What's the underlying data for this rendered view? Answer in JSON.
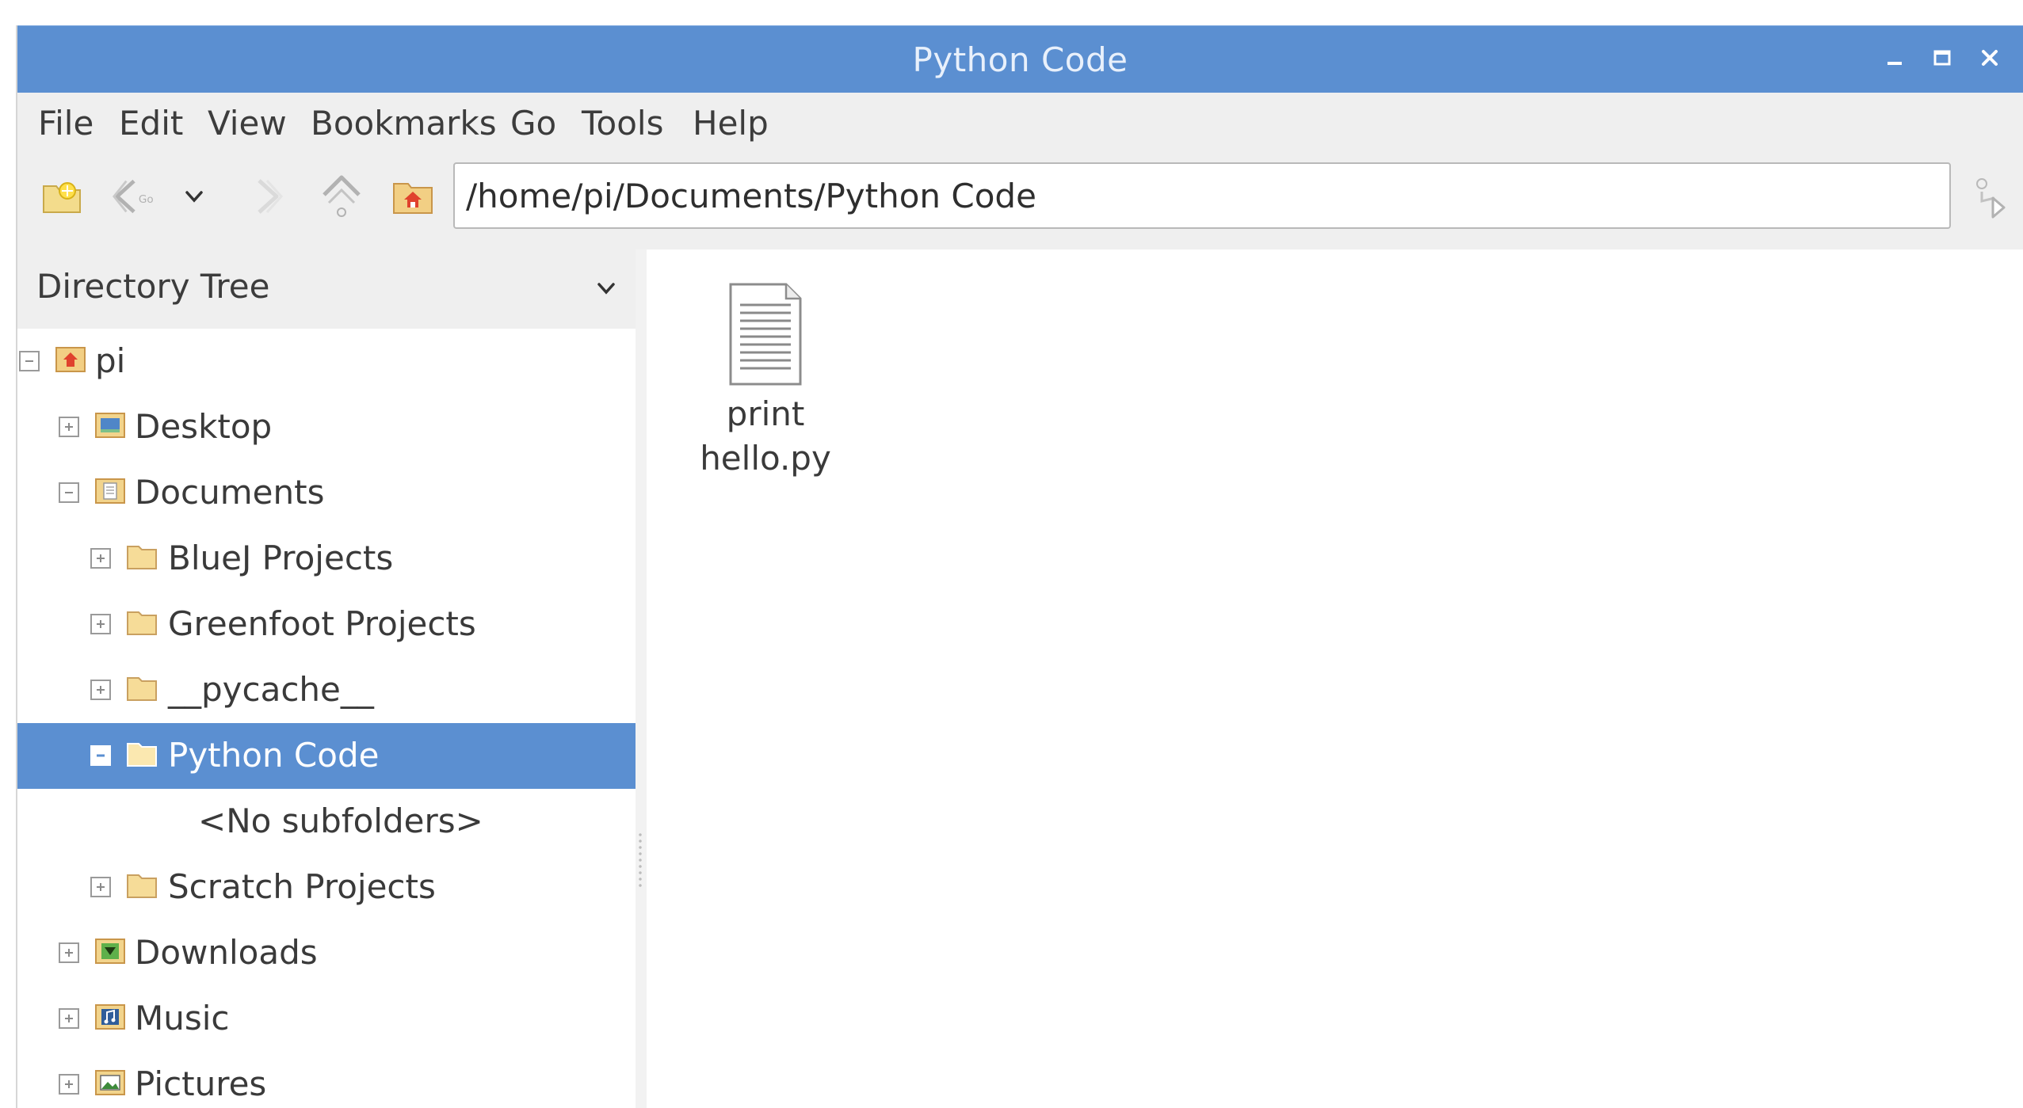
{
  "window": {
    "title": "Python Code",
    "controls": {
      "minimize": "minimize-icon",
      "maximize": "maximize-icon",
      "close": "close-icon"
    }
  },
  "menubar": {
    "items": [
      "File",
      "Edit",
      "View",
      "Bookmarks",
      "Go",
      "Tools",
      "Help"
    ]
  },
  "toolbar": {
    "buttons": [
      "new-tab-icon",
      "back-icon",
      "history-dropdown-icon",
      "forward-icon",
      "up-icon",
      "home-icon"
    ],
    "path": "/home/pi/Documents/Python Code",
    "go_icon": "go-icon"
  },
  "sidepane": {
    "header": "Directory Tree",
    "items": [
      {
        "label": "pi",
        "level": 0,
        "expanded": true,
        "icon": "home-folder-icon"
      },
      {
        "label": "Desktop",
        "level": 1,
        "expanded": false,
        "icon": "desktop-folder-icon"
      },
      {
        "label": "Documents",
        "level": 1,
        "expanded": true,
        "icon": "documents-folder-icon"
      },
      {
        "label": "BlueJ Projects",
        "level": 2,
        "expanded": false,
        "icon": "folder-icon"
      },
      {
        "label": "Greenfoot Projects",
        "level": 2,
        "expanded": false,
        "icon": "folder-icon"
      },
      {
        "label": "__pycache__",
        "level": 2,
        "expanded": false,
        "icon": "folder-icon"
      },
      {
        "label": "Python Code",
        "level": 2,
        "expanded": true,
        "selected": true,
        "icon": "folder-icon"
      },
      {
        "label": "<No subfolders>",
        "level": 3,
        "placeholder": true
      },
      {
        "label": "Scratch Projects",
        "level": 2,
        "expanded": false,
        "icon": "folder-icon"
      },
      {
        "label": "Downloads",
        "level": 1,
        "expanded": false,
        "icon": "downloads-folder-icon"
      },
      {
        "label": "Music",
        "level": 1,
        "expanded": false,
        "icon": "music-folder-icon"
      },
      {
        "label": "Pictures",
        "level": 1,
        "expanded": false,
        "icon": "pictures-folder-icon"
      }
    ]
  },
  "mainpane": {
    "files": [
      {
        "name_line1": "print",
        "name_line2": "hello.py",
        "icon": "text-file-icon"
      }
    ]
  }
}
